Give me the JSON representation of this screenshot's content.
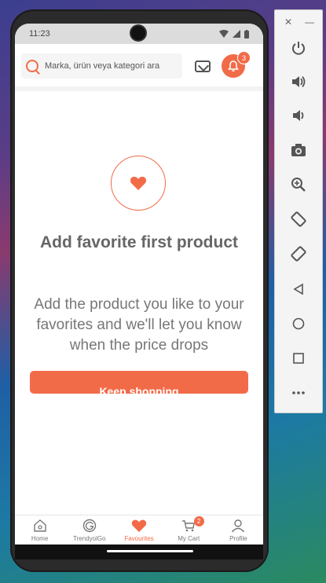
{
  "status_bar": {
    "time": "11:23"
  },
  "header": {
    "search_placeholder": "Marka, ürün veya kategori ara",
    "notification_count": "3"
  },
  "empty_state": {
    "title": "Add favorite first product",
    "subtitle": "Add the product you like to your favorites and we'll let you know when the price drops",
    "button_label": "Keep shopping"
  },
  "bottom_nav": {
    "items": [
      {
        "label": "Home",
        "icon": "home-icon",
        "active": false
      },
      {
        "label": "TrendyolGo",
        "icon": "trendyolgo-icon",
        "active": false
      },
      {
        "label": "Favourites",
        "icon": "heart-icon",
        "active": true
      },
      {
        "label": "My Cart",
        "icon": "cart-icon",
        "active": false,
        "badge": "2"
      },
      {
        "label": "Profile",
        "icon": "profile-icon",
        "active": false
      }
    ]
  },
  "emulator_toolbar": {
    "buttons": [
      "power-icon",
      "volume-up-icon",
      "volume-down-icon",
      "camera-icon",
      "zoom-icon",
      "rotate-left-icon",
      "rotate-right-icon",
      "back-icon",
      "home-circle-icon",
      "overview-icon",
      "more-icon"
    ]
  },
  "colors": {
    "accent": "#f26b49",
    "text_gray": "#666666"
  }
}
